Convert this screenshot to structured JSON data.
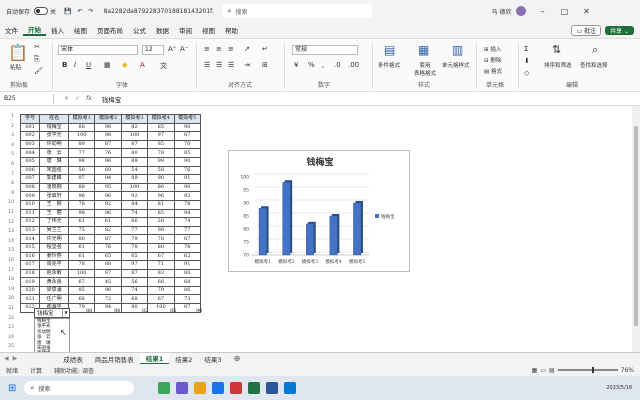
{
  "titlebar": {
    "autosave_label": "自动保存",
    "autosave_state": "关",
    "filename": "8a2282da87922837018818143201f...",
    "search_placeholder": "搜索",
    "user": "马 德欣"
  },
  "menu": [
    "文件",
    "开始",
    "插入",
    "绘图",
    "页面布局",
    "公式",
    "数据",
    "审阅",
    "视图",
    "帮助"
  ],
  "menu_right": {
    "comments": "批注",
    "share": "共享"
  },
  "ribbon": {
    "paste": "粘贴",
    "clipboard": "剪贴板",
    "font_name": "宋体",
    "font_size": "12",
    "font": "字体",
    "align": "对齐方式",
    "number_format": "常规",
    "number": "数字",
    "cond_format": "条件格式",
    "table_format": "套用\n表格格式",
    "cell_style": "单元格样式",
    "styles": "样式",
    "insert": "插入",
    "delete": "删除",
    "format": "格式",
    "cells": "单元格",
    "sort_filter": "排序和筛选",
    "find_select": "查找和选择",
    "editing": "编辑"
  },
  "formula_bar": {
    "name_box": "B25",
    "fx": "fx",
    "value": "钱梅宝"
  },
  "table": {
    "headers": [
      "学号",
      "姓名",
      "模拟考1",
      "模拟考2",
      "模拟考3",
      "模拟考4",
      "模拟考5"
    ],
    "rows": [
      [
        "001",
        "钱梅宝",
        "88",
        "98",
        "82",
        "85",
        "90"
      ],
      [
        "002",
        "张平光",
        "100",
        "98",
        "100",
        "97",
        "87"
      ],
      [
        "003",
        "许动明",
        "89",
        "87",
        "87",
        "85",
        "70"
      ],
      [
        "004",
        "张　云",
        "77",
        "76",
        "80",
        "78",
        "85"
      ],
      [
        "005",
        "唐　琳",
        "98",
        "96",
        "89",
        "99",
        "90"
      ],
      [
        "006",
        "宋国强",
        "50",
        "60",
        "54",
        "58",
        "76"
      ],
      [
        "007",
        "郭建峰",
        "97",
        "94",
        "89",
        "90",
        "91"
      ],
      [
        "008",
        "凌晓婉",
        "88",
        "95",
        "100",
        "86",
        "90"
      ],
      [
        "009",
        "张启轩",
        "98",
        "96",
        "92",
        "96",
        "92"
      ],
      [
        "010",
        "王　颖",
        "78",
        "92",
        "84",
        "81",
        "78"
      ],
      [
        "011",
        "王　丽",
        "98",
        "96",
        "74",
        "85",
        "94"
      ],
      [
        "012",
        "丁伟光",
        "61",
        "61",
        "66",
        "26",
        "74"
      ],
      [
        "013",
        "吴兰兰",
        "75",
        "82",
        "77",
        "98",
        "77"
      ],
      [
        "014",
        "许光明",
        "80",
        "87",
        "79",
        "78",
        "87"
      ],
      [
        "015",
        "程坚强",
        "61",
        "76",
        "78",
        "80",
        "76"
      ],
      [
        "016",
        "姜玲燕",
        "61",
        "65",
        "65",
        "67",
        "62"
      ],
      [
        "017",
        "周兆平",
        "78",
        "88",
        "97",
        "71",
        "91"
      ],
      [
        "018",
        "赵永敏",
        "100",
        "87",
        "87",
        "83",
        "80"
      ],
      [
        "019",
        "黄永良",
        "67",
        "45",
        "56",
        "66",
        "68"
      ],
      [
        "020",
        "梁泉涌",
        "85",
        "96",
        "74",
        "79",
        "86"
      ],
      [
        "021",
        "任广明",
        "68",
        "72",
        "68",
        "67",
        "73"
      ],
      [
        "022",
        "郝海平",
        "79",
        "94",
        "80",
        "100",
        "87"
      ]
    ],
    "row_numbers": [
      "1",
      "2",
      "3",
      "4",
      "5",
      "6",
      "7",
      "8",
      "9",
      "10",
      "11",
      "12",
      "13",
      "14",
      "15",
      "16",
      "17",
      "18",
      "19",
      "20",
      "21",
      "22",
      "23",
      "24",
      "25",
      "26",
      "27",
      "28",
      "29",
      "30",
      "31"
    ]
  },
  "selected_row": {
    "name": "钱梅宝",
    "values": [
      "88",
      "98",
      "82",
      "85",
      "90"
    ]
  },
  "dropdown_list": [
    "钱梅宝",
    "张平光",
    "许动明",
    "张　云",
    "唐　琳",
    "宋国强",
    "郭建峰",
    "凌晓婉"
  ],
  "chart_data": {
    "type": "bar",
    "title": "钱梅宝",
    "categories": [
      "模拟考1",
      "模拟考2",
      "模拟考3",
      "模拟考4",
      "模拟考5"
    ],
    "series": [
      {
        "name": "钱梅宝",
        "values": [
          88,
          98,
          82,
          85,
          90
        ]
      }
    ],
    "ylim": [
      70,
      100
    ],
    "yticks": [
      "70",
      "75",
      "80",
      "85",
      "90",
      "95",
      "100"
    ],
    "legend": "right",
    "bar_color": "#4472c4"
  },
  "sheet_tabs": [
    "成绩表",
    "商品月销售表",
    "结果1",
    "结果2",
    "结果3"
  ],
  "active_tab": "结果1",
  "status": {
    "ready": "就绪",
    "calc": "计算",
    "accessibility": "辅助功能: 调查",
    "zoom": "76%"
  },
  "taskbar": {
    "search": "搜索",
    "time": "2023/5/18"
  }
}
